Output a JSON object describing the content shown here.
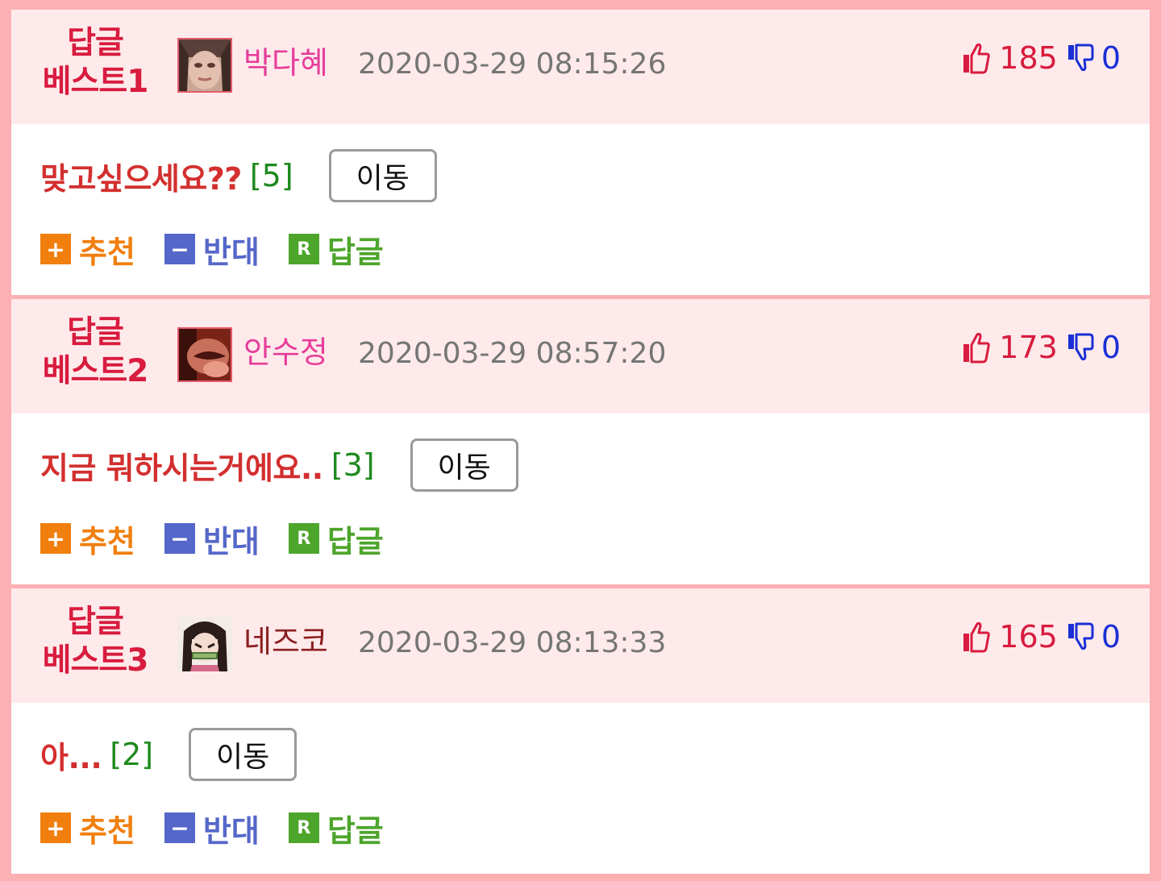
{
  "colors": {
    "background": "#fbb0b4",
    "header_bg": "#ffeaeb",
    "best_label": "#d81b3e",
    "like": "#d81b3e",
    "dislike": "#1a2fd6",
    "recommend": "#f07f0e",
    "oppose": "#5567c9",
    "reply": "#4ea52c"
  },
  "labels": {
    "move": "이동",
    "recommend": "추천",
    "oppose": "반대",
    "reply": "답글",
    "recommend_icon": "+",
    "oppose_icon": "−",
    "reply_icon": "R"
  },
  "comments": [
    {
      "rank_line1": "답글",
      "rank_line2": "베스트1",
      "nickname": "박다혜",
      "timestamp": "2020-03-29 08:15:26",
      "likes": "185",
      "dislikes": "0",
      "text": "맞고싶으세요??",
      "reply_count": "[5]",
      "avatar_icon": "face-photo-avatar"
    },
    {
      "rank_line1": "답글",
      "rank_line2": "베스트2",
      "nickname": "안수정",
      "timestamp": "2020-03-29 08:57:20",
      "likes": "173",
      "dislikes": "0",
      "text": "지금 뭐하시는거에요..",
      "reply_count": "[3]",
      "avatar_icon": "eye-closeup-avatar"
    },
    {
      "rank_line1": "답글",
      "rank_line2": "베스트3",
      "nickname": "네즈코",
      "timestamp": "2020-03-29 08:13:33",
      "likes": "165",
      "dislikes": "0",
      "text": "아...",
      "reply_count": "[2]",
      "avatar_icon": "anime-character-avatar"
    }
  ]
}
